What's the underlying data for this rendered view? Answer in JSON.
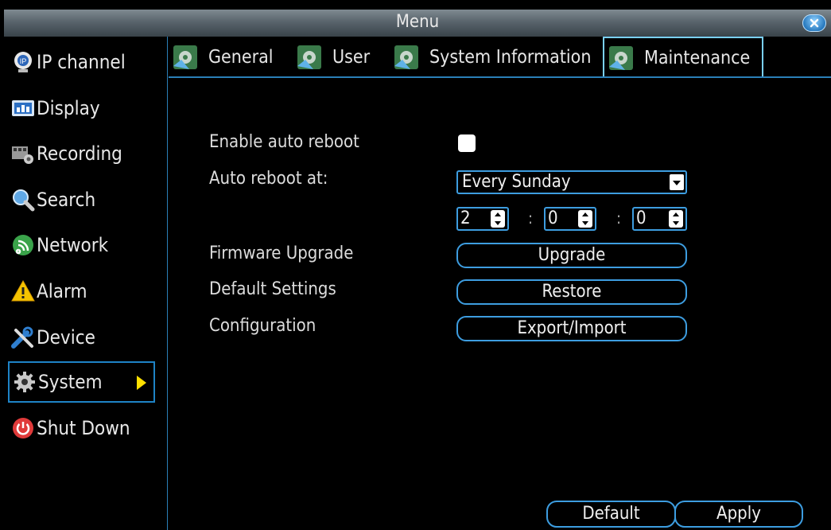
{
  "window": {
    "title": "Menu"
  },
  "sidebar": {
    "items": [
      {
        "label": "IP channel",
        "icon": "ip-camera-icon"
      },
      {
        "label": "Display",
        "icon": "display-icon"
      },
      {
        "label": "Recording",
        "icon": "recording-icon"
      },
      {
        "label": "Search",
        "icon": "search-icon"
      },
      {
        "label": "Network",
        "icon": "network-icon"
      },
      {
        "label": "Alarm",
        "icon": "alarm-icon"
      },
      {
        "label": "Device",
        "icon": "device-tools-icon"
      },
      {
        "label": "System",
        "icon": "gear-icon",
        "active": true
      },
      {
        "label": "Shut Down",
        "icon": "power-icon"
      }
    ]
  },
  "tabs": [
    {
      "label": "General"
    },
    {
      "label": "User"
    },
    {
      "label": "System Information"
    },
    {
      "label": "Maintenance",
      "active": true
    }
  ],
  "form": {
    "auto_reboot_label": "Enable auto reboot",
    "auto_reboot_checked": false,
    "reboot_at_label": "Auto reboot at:",
    "reboot_day": "Every Sunday",
    "hour": "2",
    "minute": "0",
    "second": "0",
    "time_separator": ":",
    "firmware_label": "Firmware Upgrade",
    "upgrade_button": "Upgrade",
    "default_label": "Default Settings",
    "restore_button": "Restore",
    "config_label": "Configuration",
    "export_button": "Export/Import"
  },
  "footer": {
    "default_button": "Default",
    "apply_button": "Apply"
  },
  "colors": {
    "accent": "#3d9de0",
    "active_arrow": "#ffe000"
  }
}
